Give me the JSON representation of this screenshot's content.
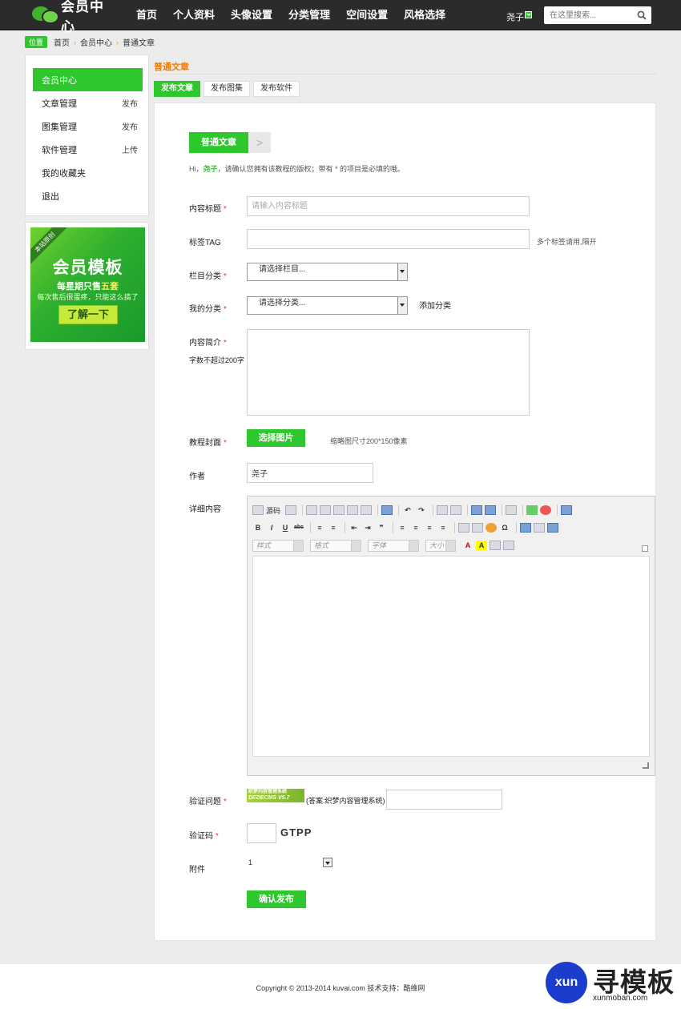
{
  "header": {
    "logo_text": "会员中心",
    "nav": [
      "首页",
      "个人资料",
      "头像设置",
      "分类管理",
      "空间设置",
      "风格选择"
    ],
    "user_name": "尧子",
    "search_placeholder": "在这里搜索..."
  },
  "breadcrumb": {
    "tag": "位置",
    "items": [
      "首页",
      "会员中心",
      "普通文章"
    ]
  },
  "sidebar": {
    "items": [
      {
        "label": "会员中心",
        "action": ""
      },
      {
        "label": "文章管理",
        "action": "发布"
      },
      {
        "label": "图集管理",
        "action": "发布"
      },
      {
        "label": "软件管理",
        "action": "上传"
      },
      {
        "label": "我的收藏夹",
        "action": ""
      },
      {
        "label": "退出",
        "action": ""
      }
    ]
  },
  "ad": {
    "ribbon": "本站原创",
    "title": "会员模板",
    "line1_a": "每星期只售",
    "line1_b": "五套",
    "line2": "每次售后很蛋疼，只能这么搞了",
    "button": "了解一下"
  },
  "section": {
    "title": "普通文章",
    "tabs": [
      "发布文章",
      "发布图集",
      "发布软件"
    ]
  },
  "form": {
    "step": "普通文章",
    "step_next": ">",
    "hint_pre": "Hi，",
    "hint_user": "尧子",
    "hint_post": "，请确认您拥有该教程的版权；带有 * 的项目是必填的哦。",
    "required_mark": "*",
    "title_label": "内容标题",
    "title_placeholder": "请输入内容标题",
    "tag_label": "标签TAG",
    "tag_note": "多个标签请用,隔开",
    "column_label": "栏目分类",
    "column_value": "请选择栏目...",
    "mycat_label": "我的分类",
    "mycat_value": "请选择分类...",
    "mycat_add": "添加分类",
    "intro_label": "内容简介",
    "intro_note": "字数不超过200字",
    "cover_label": "教程封面",
    "cover_button": "选择图片",
    "cover_note": "缩略图尺寸200*150像素",
    "author_label": "作者",
    "author_value": "尧子",
    "detail_label": "详细内容",
    "editor": {
      "source": "源码",
      "combo_style": "样式",
      "combo_format": "格式",
      "combo_font": "字体",
      "combo_size": "大小"
    },
    "question_label": "验证问题",
    "question_img_line1": "织梦内容管理系统",
    "question_img_line2": "DEDECMS V5.7",
    "question_answer_hint": "(答案:织梦内容管理系统)",
    "vcode_label": "验证码",
    "vcode_text": "GTPP",
    "attach_label": "附件",
    "attach_value": "1",
    "submit": "确认发布"
  },
  "footer": {
    "text": "Copyright © 2013-2014 kuvai.com 技术支持：酷维网"
  },
  "watermark": {
    "circle": "xun",
    "title": "寻模板",
    "sub": "xunmoban.com"
  }
}
